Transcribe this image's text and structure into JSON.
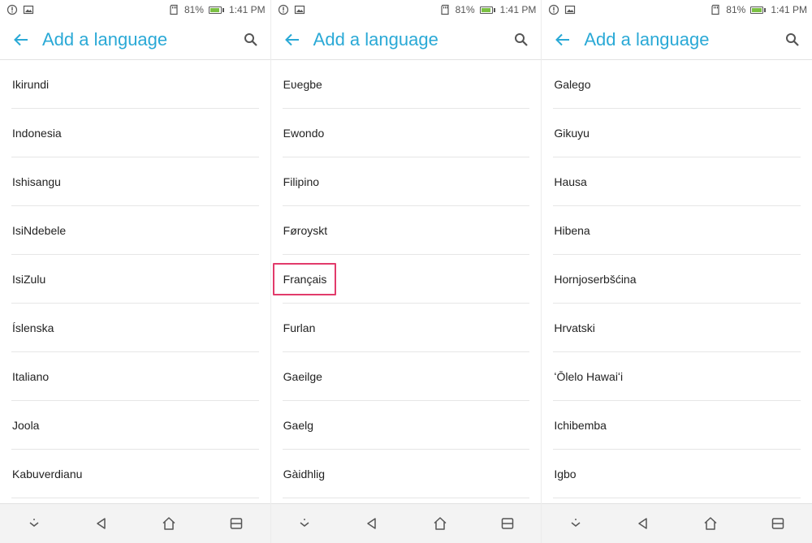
{
  "status_bar": {
    "battery": "81%",
    "time": "1:41 PM"
  },
  "app_bar": {
    "title": "Add a language"
  },
  "colors": {
    "accent": "#2aa9d6",
    "highlight": "#e23b6b",
    "battery_fill": "#7bc043"
  },
  "panels": [
    {
      "items": [
        "Ikirundi",
        "Indonesia",
        "Ishisangu",
        "IsiNdebele",
        "IsiZulu",
        "Íslenska",
        "Italiano",
        "Joola",
        "Kabuverdianu"
      ]
    },
    {
      "items": [
        "Eʋegbe",
        "Ewondo",
        "Filipino",
        "Føroyskt",
        "Français",
        "Furlan",
        "Gaeilge",
        "Gaelg",
        "Gàidhlig"
      ],
      "highlighted_index": 4
    },
    {
      "items": [
        "Galego",
        "Gikuyu",
        "Hausa",
        "Hibena",
        "Hornjoserbšćina",
        "Hrvatski",
        "ʻŌlelo Hawaiʻi",
        "Ichibemba",
        "Igbo"
      ]
    }
  ],
  "icons": {
    "back": "arrow-back-icon",
    "search": "search-icon",
    "nav": [
      "chevron-down-icon",
      "back-triangle-icon",
      "home-icon",
      "recents-icon"
    ]
  }
}
